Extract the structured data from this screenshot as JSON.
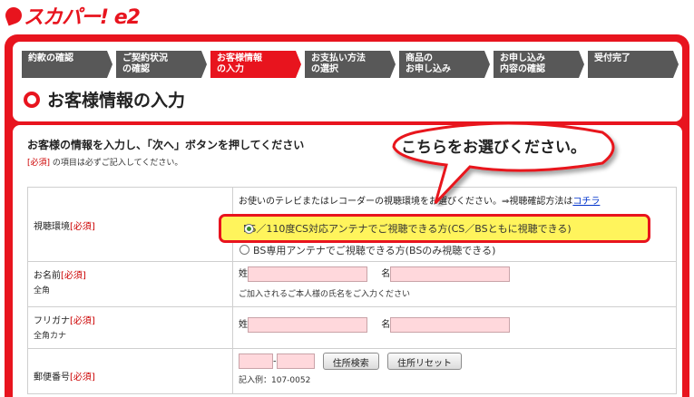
{
  "logo": "スカパー! e2",
  "steps": [
    {
      "line1": "約款の確認",
      "line2": ""
    },
    {
      "line1": "ご契約状況",
      "line2": "の確認"
    },
    {
      "line1": "お客様情報",
      "line2": "の入力"
    },
    {
      "line1": "お支払い方法",
      "line2": "の選択"
    },
    {
      "line1": "商品の",
      "line2": "お申し込み"
    },
    {
      "line1": "お申し込み",
      "line2": "内容の確認"
    },
    {
      "line1": "受付完了",
      "line2": ""
    }
  ],
  "page_title": "お客様情報の入力",
  "instruction": "お客様の情報を入力し、「次へ」ボタンを押してください",
  "note": {
    "req": "[必須]",
    "text": "の項目は必ずご記入してください。"
  },
  "callout": "こちらをお選びください。",
  "viewing": {
    "label": "視聴環境",
    "req": "[必須]",
    "desc": "お使いのテレビまたはレコーダーの視聴環境をお選びください。⇒視聴確認方法は",
    "link": "コチラ",
    "option1": "BS／110度CS対応アンテナでご視聴できる方(CS／BSともに視聴できる)",
    "option2": "BS専用アンテナでご視聴できる方(BSのみ視聴できる)"
  },
  "name": {
    "label": "お名前",
    "req": "[必須]",
    "sub": "全角",
    "sei": "姓",
    "mei": "名",
    "hint": "ご加入されるご本人様の氏名をご入力ください"
  },
  "kana": {
    "label": "フリガナ",
    "req": "[必須]",
    "sub": "全角カナ",
    "sei": "姓",
    "mei": "名"
  },
  "postal": {
    "label": "郵便番号",
    "req": "[必須]",
    "sep": "-",
    "search_btn": "住所検索",
    "reset_btn": "住所リセット",
    "example": "記入例：107-0052"
  },
  "colors": {
    "brand_red": "#e8141e",
    "highlight_yellow": "#fff45c",
    "input_pink": "#ffd8dc"
  }
}
